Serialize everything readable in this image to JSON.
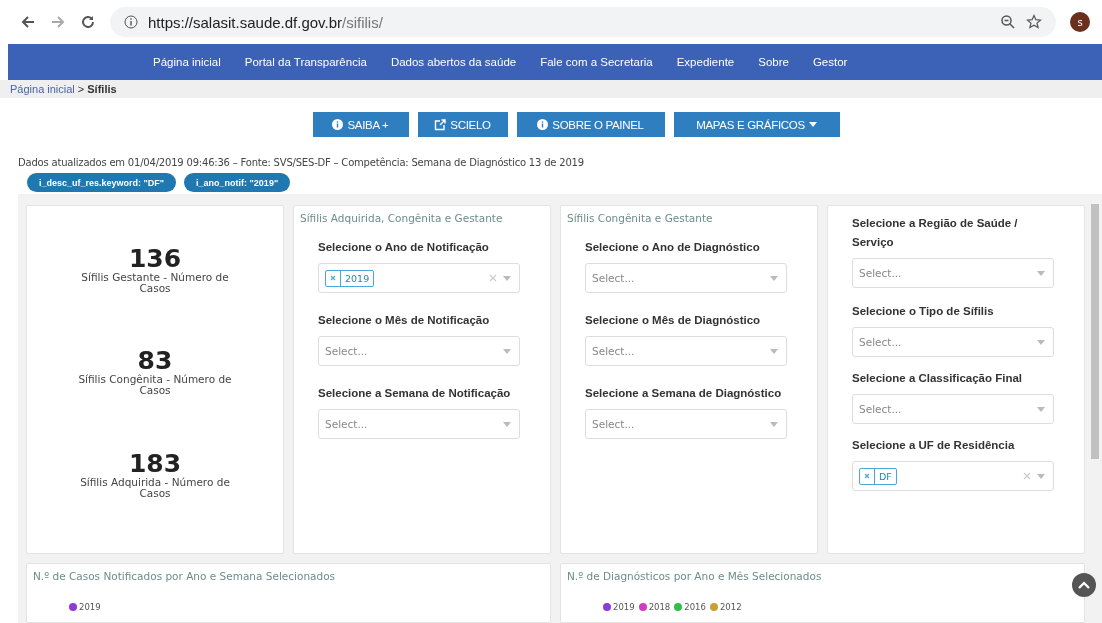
{
  "browser": {
    "url_host": "https://salasit.saude.df.gov.br",
    "url_path": "/sifilis/",
    "avatar": "s"
  },
  "nav": [
    "Página inicial",
    "Portal da Transparência",
    "Dados abertos da saúde",
    "Fale com a Secretaria",
    "Expediente",
    "Sobre",
    "Gestor"
  ],
  "breadcrumb": {
    "link": "Página inicial",
    "separator": ">",
    "current": "Sífilis"
  },
  "buttons": [
    {
      "label": "SAIBA +",
      "kind": "info"
    },
    {
      "label": "SCIELO",
      "kind": "link"
    },
    {
      "label": "SOBRE O PAINEL",
      "kind": "info"
    },
    {
      "label": "MAPAS E GRÁFICOS",
      "kind": "menu"
    }
  ],
  "info_line": "Dados atualizados em 01/04/2019 09:46:36 – Fonte: SVS/SES-DF – Competência: Semana de Diagnóstico 13 de 2019",
  "filter_chips": [
    "i_desc_uf_res.keyword: \"DF\"",
    "i_ano_notif: \"2019\""
  ],
  "metrics": [
    {
      "value": "136",
      "label": "Sífilis Gestante - Número de Casos"
    },
    {
      "value": "83",
      "label": "Sífilis Congênita - Número de Casos"
    },
    {
      "value": "183",
      "label": "Sífilis Adquirida - Número de Casos"
    }
  ],
  "filter_panels": [
    {
      "title": "Sífilis Adquirida, Congênita e Gestante",
      "fields": [
        {
          "label": "Selecione o Ano de Notificação",
          "tags": [
            "2019"
          ]
        },
        {
          "label": "Selecione o Mês de Notificação",
          "placeholder": "Select..."
        },
        {
          "label": "Selecione a Semana de Notificação",
          "placeholder": "Select..."
        }
      ]
    },
    {
      "title": "Sífilis Congênita e Gestante",
      "fields": [
        {
          "label": "Selecione o Ano de Diagnóstico",
          "placeholder": "Select..."
        },
        {
          "label": "Selecione o Mês de Diagnóstico",
          "placeholder": "Select..."
        },
        {
          "label": "Selecione a Semana de Diagnóstico",
          "placeholder": "Select..."
        }
      ]
    },
    {
      "fields": [
        {
          "label": "Selecione a Região de Saúde / Serviço",
          "placeholder": "Select..."
        },
        {
          "label": "Selecione o Tipo de Sífilis",
          "placeholder": "Select..."
        },
        {
          "label": "Selecione a Classificação Final",
          "placeholder": "Select..."
        },
        {
          "label": "Selecione a UF de Residência",
          "tags": [
            "DF"
          ]
        }
      ]
    }
  ],
  "chart_panels": [
    {
      "title": "N.º de Casos Notificados por Ano e Semana Selecionados",
      "legend": [
        {
          "name": "2019",
          "color": "#8e3bd6"
        }
      ]
    },
    {
      "title": "N.º de Diagnósticos por Ano e Mês Selecionados",
      "legend": [
        {
          "name": "2019",
          "color": "#8e3bd6"
        },
        {
          "name": "2018",
          "color": "#d13bbf"
        },
        {
          "name": "2016",
          "color": "#2fbf4a"
        },
        {
          "name": "2012",
          "color": "#c9a034"
        }
      ]
    }
  ]
}
